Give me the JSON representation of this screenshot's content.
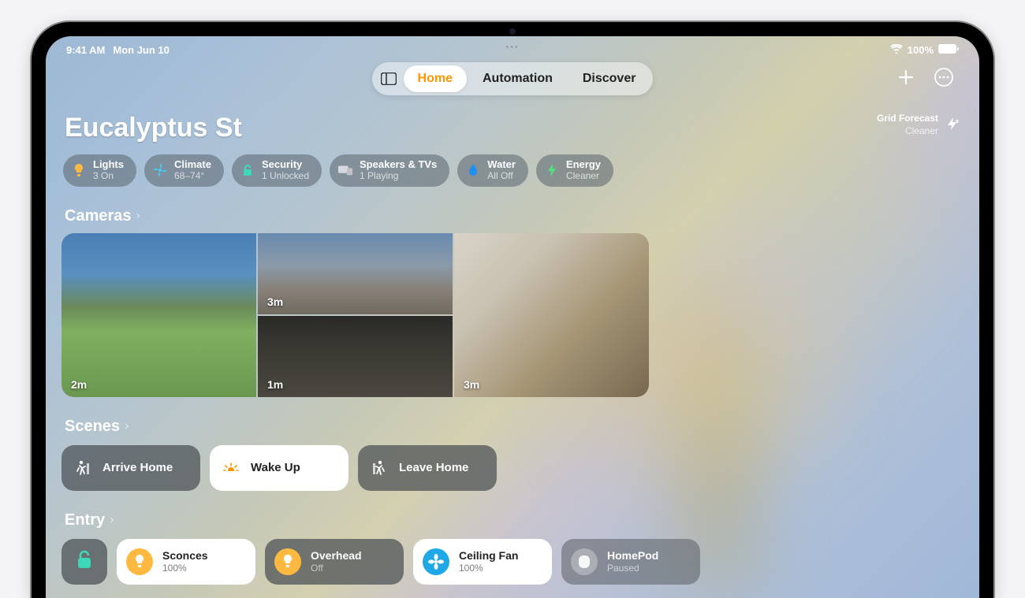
{
  "status": {
    "time": "9:41 AM",
    "date": "Mon Jun 10",
    "battery": "100%"
  },
  "tabs": {
    "home": "Home",
    "automation": "Automation",
    "discover": "Discover"
  },
  "home_title": "Eucalyptus St",
  "forecast": {
    "label": "Grid Forecast",
    "status": "Cleaner"
  },
  "chips": {
    "lights": {
      "label": "Lights",
      "status": "3 On"
    },
    "climate": {
      "label": "Climate",
      "status": "68–74°"
    },
    "security": {
      "label": "Security",
      "status": "1 Unlocked"
    },
    "speakers": {
      "label": "Speakers & TVs",
      "status": "1 Playing"
    },
    "water": {
      "label": "Water",
      "status": "All Off"
    },
    "energy": {
      "label": "Energy",
      "status": "Cleaner"
    }
  },
  "sections": {
    "cameras": "Cameras",
    "scenes": "Scenes",
    "entry": "Entry"
  },
  "cameras": {
    "c1": "2m",
    "c2": "3m",
    "c3": "1m",
    "c4": "3m"
  },
  "scenes": {
    "arrive": "Arrive Home",
    "wake": "Wake Up",
    "leave": "Leave Home"
  },
  "entry": {
    "sconces": {
      "label": "Sconces",
      "status": "100%"
    },
    "overhead": {
      "label": "Overhead",
      "status": "Off"
    },
    "fan": {
      "label": "Ceiling Fan",
      "status": "100%"
    },
    "homepod": {
      "label": "HomePod",
      "status": "Paused"
    }
  }
}
